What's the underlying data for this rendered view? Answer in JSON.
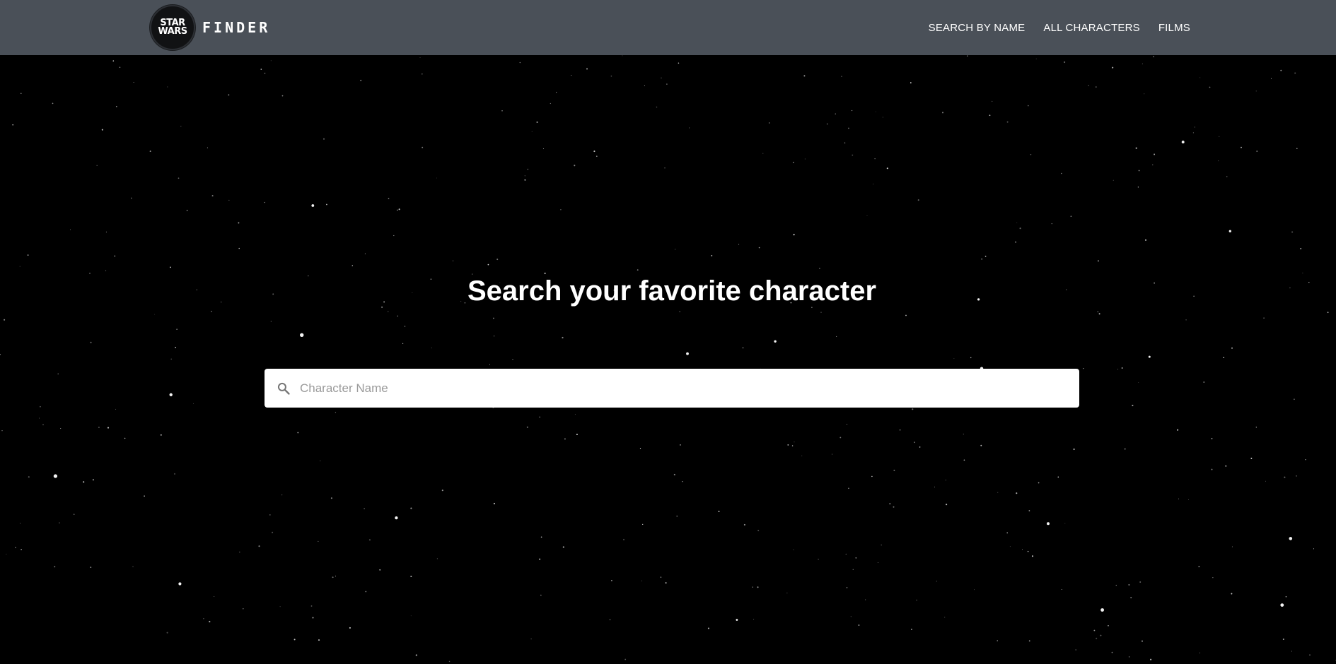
{
  "header": {
    "logo_line1": "STAR",
    "logo_line2": "WARS",
    "brand": "FINDER",
    "nav": [
      {
        "label": "SEARCH BY NAME"
      },
      {
        "label": "ALL CHARACTERS"
      },
      {
        "label": "FILMS"
      }
    ]
  },
  "hero": {
    "title": "Search your favorite character"
  },
  "search": {
    "placeholder": "Character Name",
    "value": ""
  },
  "icons": {
    "search": "search-icon"
  },
  "colors": {
    "topbar": "#4a5058",
    "background": "#000000",
    "text": "#ffffff"
  }
}
